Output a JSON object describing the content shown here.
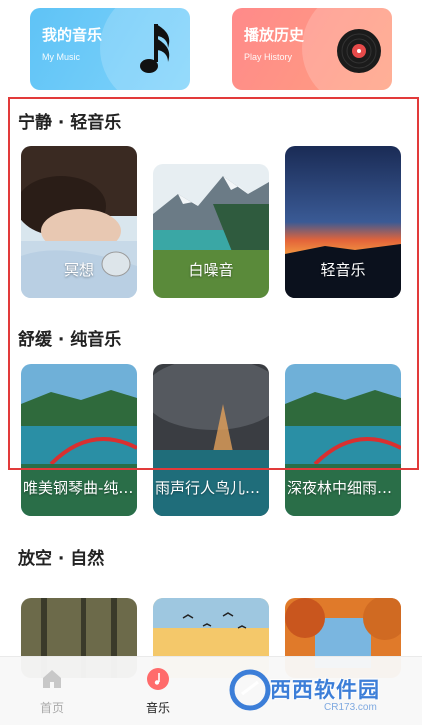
{
  "top_cards": [
    {
      "title": "我的音乐",
      "subtitle": "My Music",
      "icon": "music-note-icon",
      "color": "#6ccaf8"
    },
    {
      "title": "播放历史",
      "subtitle": "Play History",
      "icon": "vinyl-record-icon",
      "color": "#ff8e88"
    }
  ],
  "sections": [
    {
      "title": "宁静 · 轻音乐",
      "items": [
        {
          "label": "冥想"
        },
        {
          "label": "白噪音"
        },
        {
          "label": "轻音乐"
        }
      ]
    },
    {
      "title": "舒缓 · 纯音乐",
      "items": [
        {
          "label": "唯美钢琴曲-纯…"
        },
        {
          "label": "雨声行人鸟儿…"
        },
        {
          "label": "深夜林中细雨…"
        }
      ]
    },
    {
      "title": "放空 · 自然",
      "items": [
        {
          "label": ""
        },
        {
          "label": ""
        },
        {
          "label": ""
        }
      ]
    }
  ],
  "bottom_nav": [
    {
      "label": "首页",
      "icon": "home-icon",
      "active": false
    },
    {
      "label": "音乐",
      "icon": "music-disc-icon",
      "active": true
    }
  ],
  "watermark": {
    "text": "西西软件园",
    "url": "CR173.com"
  },
  "colors": {
    "highlight": "#e23a3a",
    "active_nav": "#ff6b6b"
  }
}
